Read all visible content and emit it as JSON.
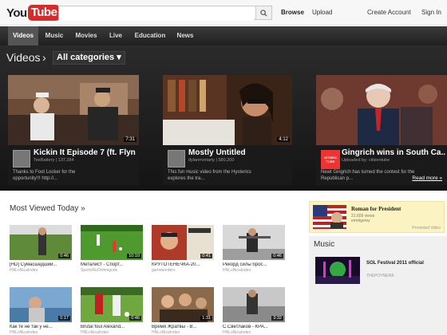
{
  "header": {
    "logo_you": "You",
    "logo_tube": "Tube",
    "search_placeholder": "",
    "browse": "Browse",
    "upload": "Upload",
    "create_account": "Create Account",
    "sign_in": "Sign In"
  },
  "nav": [
    "Videos",
    "Music",
    "Movies",
    "Live",
    "Education",
    "News"
  ],
  "hero": {
    "title": "Videos",
    "category": "All categories ▾",
    "cards": [
      {
        "title": "Kickin It Episode 7 (ft. Flyn...",
        "by": "TeeBattery | 137,284",
        "desc": "Thanks to Foot Locker for the opportunity!!! http://...",
        "duration": "7:31",
        "read_more": ""
      },
      {
        "title": "Mostly Untitled",
        "by": "dylanmoriarty | 580,200",
        "desc": "This fun music video from the Hysterics explores the tra...",
        "duration": "4:12",
        "read_more": ""
      },
      {
        "title": "Gingrich wins in South Ca...",
        "by": "Uploaded by: citizentube",
        "desc": "Newt Gingrich has turned the contest for the Republican p...",
        "duration": "",
        "read_more": "Read more »"
      }
    ]
  },
  "most_viewed": {
    "title": "Most Viewed Today »",
    "videos": [
      {
        "title": "[HD] Сумасшедший...",
        "by": "HNLoNicaIndeo",
        "duration": "0:46"
      },
      {
        "title": "Металист - Спорт...",
        "by": "SportsRuOnlinegods",
        "duration": "10:10"
      },
      {
        "title": "КРУТОТЕНЕЧКА-20...",
        "by": "gameborders",
        "duration": "0:41"
      },
      {
        "title": "Рекорд силы брос...",
        "by": "HNLoNicaIndeo",
        "duration": "0:46"
      },
      {
        "title": "Как те не так у не...",
        "by": "HNLoNicaIndeo",
        "duration": "0:17"
      },
      {
        "title": "Brutal foul Alexand...",
        "by": "HNLoNicaIndeo",
        "duration": "0:46"
      },
      {
        "title": "Время Жратвы - В...",
        "by": "HNLoNicaIndeo",
        "duration": "1:31"
      },
      {
        "title": "С.Светлаков - КРА...",
        "by": "HNLoNicaIndeo",
        "duration": "3:32"
      }
    ]
  },
  "promoted": {
    "title": "Roman for President",
    "views": "21,609 views",
    "by": "emrkgorey",
    "label": "Promoted Video"
  },
  "music": {
    "title": "Music",
    "video_title": "SOL Festival 2011 official",
    "video_by": "THEPOYNERA"
  }
}
